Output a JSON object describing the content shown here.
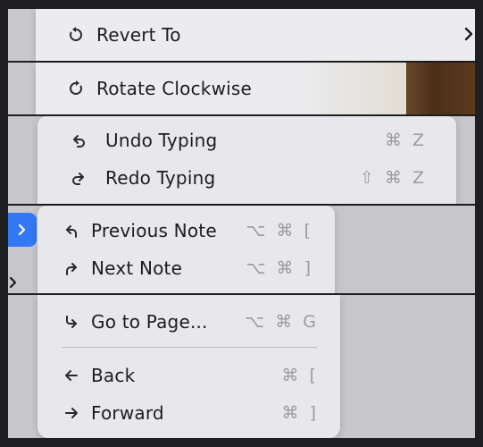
{
  "menu1": {
    "revert_label": "Revert To"
  },
  "menu2": {
    "rotate_label": "Rotate Clockwise"
  },
  "menu3": {
    "undo_label": "Undo Typing",
    "undo_shortcut": "⌘ Z",
    "redo_label": "Redo Typing",
    "redo_shortcut": "⇧ ⌘ Z"
  },
  "menu4": {
    "prev_label": "Previous Note",
    "prev_shortcut": "⌥ ⌘ [",
    "next_label": "Next Note",
    "next_shortcut": "⌥ ⌘ ]"
  },
  "menu5": {
    "goto_label": "Go to Page...",
    "goto_shortcut": "⌥ ⌘ G",
    "back_label": "Back",
    "back_shortcut": "⌘ [",
    "forward_label": "Forward",
    "forward_shortcut": "⌘ ]"
  },
  "colors": {
    "accent": "#3478f6",
    "menu_bg": "#e8e8ec",
    "shortcut": "#9a9aa0"
  }
}
